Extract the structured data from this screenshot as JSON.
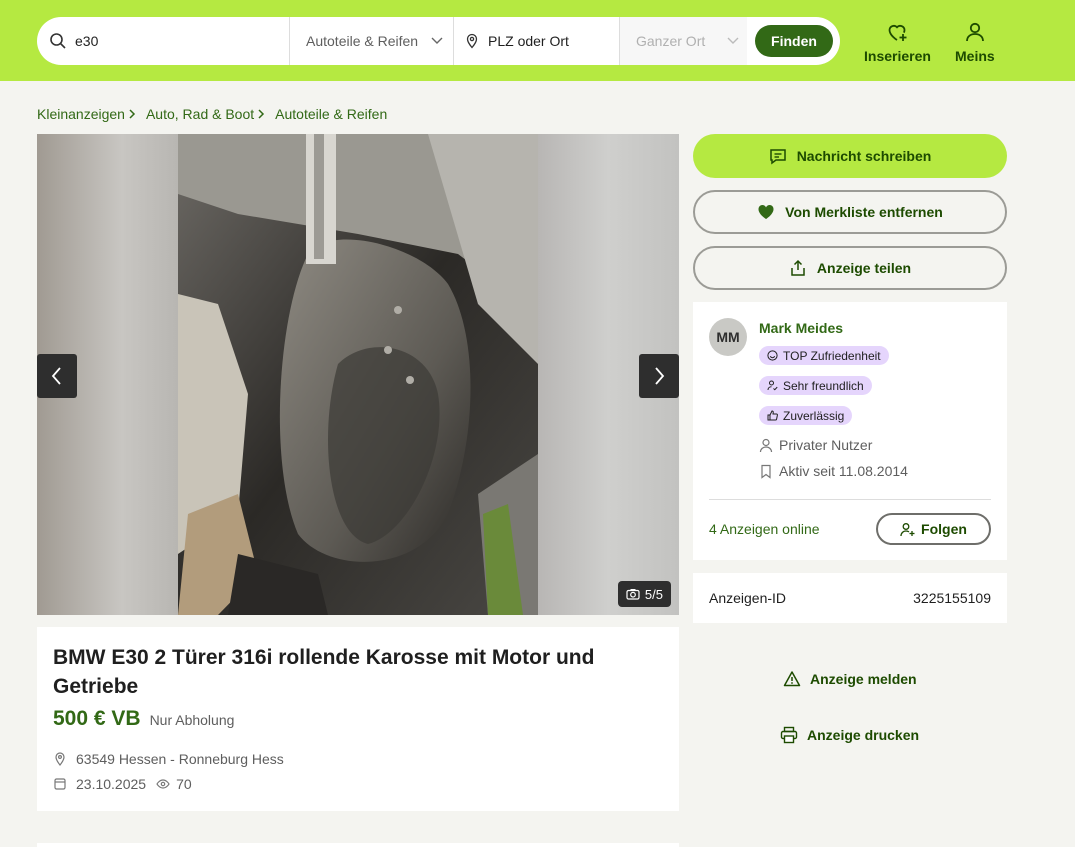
{
  "header": {
    "search_value": "e30",
    "category": "Autoteile & Reifen",
    "location_placeholder": "PLZ oder Ort",
    "radius": "Ganzer Ort",
    "find_label": "Finden",
    "post_label": "Inserieren",
    "account_label": "Meins",
    "accent_color": "#b5e941",
    "button_color": "#326916"
  },
  "breadcrumb": [
    {
      "label": "Kleinanzeigen"
    },
    {
      "label": "Auto, Rad & Boot"
    },
    {
      "label": "Autoteile & Reifen"
    }
  ],
  "gallery": {
    "counter": "5/5",
    "prev_icon": "chevron-left-icon",
    "next_icon": "chevron-right-icon"
  },
  "ad": {
    "title": "BMW E30 2 Türer 316i rollende Karosse mit Motor und Getriebe",
    "price": "500 € VB",
    "shipping": "Nur Abholung",
    "location": "63549 Hessen - Ronneburg Hess",
    "date": "23.10.2025",
    "views": "70"
  },
  "actions": {
    "message": "Nachricht schreiben",
    "watchlist": "Von Merkliste entfernen",
    "share": "Anzeige teilen",
    "report": "Anzeige melden",
    "print": "Anzeige drucken"
  },
  "seller": {
    "initials": "MM",
    "name": "Mark Meides",
    "badges": [
      "TOP Zufriedenheit",
      "Sehr freundlich",
      "Zuverlässig"
    ],
    "type": "Privater Nutzer",
    "active_since": "Aktiv seit 11.08.2014",
    "ads_online": "4 Anzeigen online",
    "follow_label": "Folgen",
    "badge_color": "#e5d5fc"
  },
  "ad_id": {
    "label": "Anzeigen-ID",
    "value": "3225155109"
  }
}
